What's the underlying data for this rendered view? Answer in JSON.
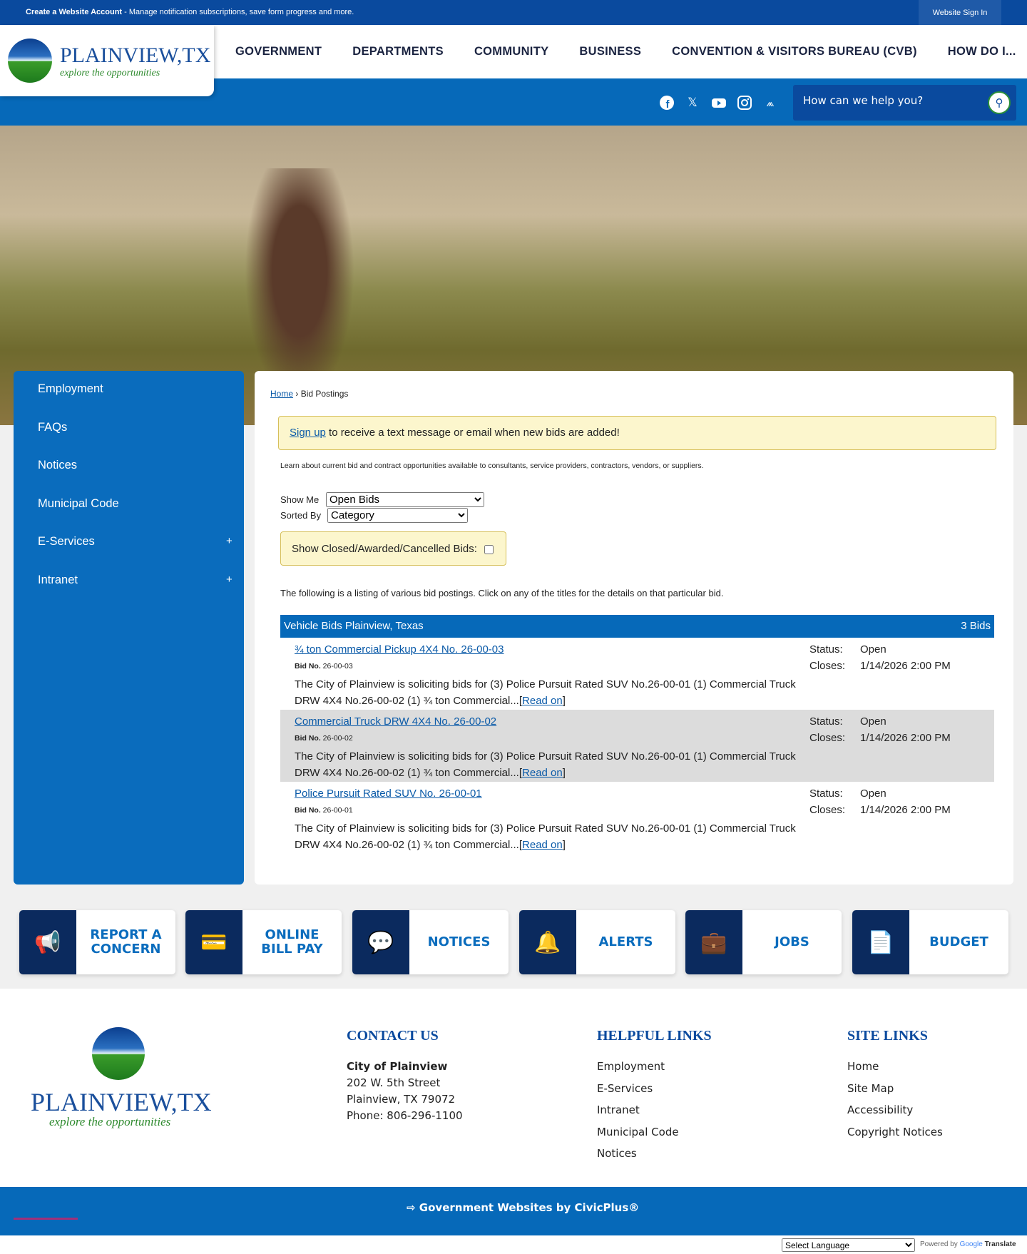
{
  "topbar": {
    "account_link": "Create a Website Account",
    "account_desc": " - Manage notification subscriptions, save form progress and more.",
    "signin": "Website Sign In"
  },
  "logo": {
    "name": "PLAINVIEW,TX",
    "tagline": "explore the opportunities"
  },
  "nav": [
    "GOVERNMENT",
    "DEPARTMENTS",
    "COMMUNITY",
    "BUSINESS",
    "CONVENTION & VISITORS BUREAU (CVB)",
    "HOW DO I..."
  ],
  "social": [
    "facebook-icon",
    "x-icon",
    "youtube-icon",
    "instagram-icon",
    "civic-icon"
  ],
  "search": {
    "placeholder": "How can we help you?"
  },
  "sidebar": [
    {
      "label": "Employment"
    },
    {
      "label": "FAQs"
    },
    {
      "label": "Notices"
    },
    {
      "label": "Municipal Code"
    },
    {
      "label": "E-Services",
      "expand": "+"
    },
    {
      "label": "Intranet",
      "expand": "+"
    }
  ],
  "breadcrumb": {
    "home": "Home",
    "sep": "›",
    "current": "Bid Postings"
  },
  "alert": {
    "link": "Sign up",
    "text": " to receive a text message or email when new bids are added!"
  },
  "intro": "Learn about current bid and contract opportunities available to consultants, service providers, contractors, vendors, or suppliers.",
  "filters": {
    "show_me_label": "Show Me",
    "show_me_value": "Open Bids",
    "sorted_by_label": "Sorted By",
    "sorted_by_value": "Category",
    "closed_label": "Show Closed/Awarded/Cancelled Bids:"
  },
  "listing_intro": "The following is a listing of various bid postings. Click on any of the titles for the details on that particular bid.",
  "category": {
    "name": "Vehicle Bids Plainview, Texas",
    "count": "3 Bids"
  },
  "bids": [
    {
      "title": "¾ ton Commercial Pickup 4X4 No. 26-00-03",
      "bid_no_label": "Bid No.",
      "bid_no": "26-00-03",
      "desc": "The City of Plainview is soliciting bids for (3) Police Pursuit Rated SUV No.26-00-01 (1) Commercial Truck DRW 4X4 No.26-00-02 (1) ¾ ton Commercial...",
      "read_on": "Read on",
      "status_label": "Status:",
      "status": "Open",
      "closes_label": "Closes:",
      "closes": "1/14/2026 2:00 PM"
    },
    {
      "title": "Commercial Truck DRW 4X4 No. 26-00-02",
      "bid_no_label": "Bid No.",
      "bid_no": "26-00-02",
      "desc": "The City of Plainview is soliciting bids for (3) Police Pursuit Rated SUV No.26-00-01 (1) Commercial Truck DRW 4X4 No.26-00-02 (1) ¾ ton Commercial...",
      "read_on": "Read on",
      "status_label": "Status:",
      "status": "Open",
      "closes_label": "Closes:",
      "closes": "1/14/2026 2:00 PM"
    },
    {
      "title": "Police Pursuit Rated SUV No. 26-00-01",
      "bid_no_label": "Bid No.",
      "bid_no": "26-00-01",
      "desc": "The City of Plainview is soliciting bids for (3) Police Pursuit Rated SUV No.26-00-01 (1) Commercial Truck DRW 4X4 No.26-00-02 (1) ¾ ton Commercial...",
      "read_on": "Read on",
      "status_label": "Status:",
      "status": "Open",
      "closes_label": "Closes:",
      "closes": "1/14/2026 2:00 PM"
    }
  ],
  "tiles": [
    {
      "label": "REPORT A CONCERN",
      "icon": "megaphone-icon"
    },
    {
      "label": "ONLINE BILL PAY",
      "icon": "credit-card-icon"
    },
    {
      "label": "NOTICES",
      "icon": "chat-bell-icon"
    },
    {
      "label": "ALERTS",
      "icon": "bell-icon"
    },
    {
      "label": "JOBS",
      "icon": "briefcase-icon"
    },
    {
      "label": "BUDGET",
      "icon": "document-dollar-icon"
    }
  ],
  "footer": {
    "contact": {
      "heading": "CONTACT US",
      "org": "City of Plainview",
      "address1": "202 W. 5th Street",
      "address2": "Plainview, TX 79072",
      "phone": "Phone: 806-296-1100"
    },
    "helpful": {
      "heading": "HELPFUL LINKS",
      "links": [
        "Employment",
        "E-Services",
        "Intranet",
        "Municipal Code",
        "Notices"
      ]
    },
    "site": {
      "heading": "SITE LINKS",
      "links": [
        "Home",
        "Site Map",
        "Accessibility",
        "Copyright Notices"
      ]
    },
    "civicplus": "Government Websites by CivicPlus®",
    "language": "Select Language",
    "powered": "Powered by",
    "google": "Google",
    "translate": "Translate"
  }
}
